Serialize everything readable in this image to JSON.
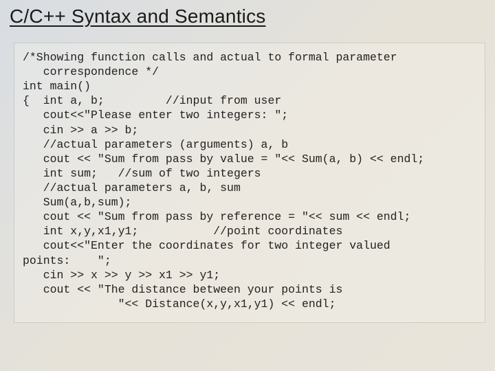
{
  "slide": {
    "title": "C/C++ Syntax and Semantics",
    "code": {
      "line1": "/*Showing function calls and actual to formal parameter",
      "line2": "   correspondence */",
      "line3": "int main()",
      "line4": "{  int a, b;         //input from user",
      "line5": "   cout<<\"Please enter two integers: \";",
      "line6": "   cin >> a >> b;",
      "line7": "   //actual parameters (arguments) a, b",
      "line8": "   cout << \"Sum from pass by value = \"<< Sum(a, b) << endl;",
      "line9": "   int sum;   //sum of two integers",
      "line10": "   //actual parameters a, b, sum",
      "line11": "   Sum(a,b,sum);",
      "line12": "   cout << \"Sum from pass by reference = \"<< sum << endl;",
      "line13": "   int x,y,x1,y1;           //point coordinates",
      "line14a": "   cout<<\"Enter the coordinates for two integer valued",
      "line14b": "points:    \";",
      "line15": "   cin >> x >> y >> x1 >> y1;",
      "line16a": "   cout << \"The distance between your points is",
      "line16b": "              \"<< Distance(x,y,x1,y1) << endl;"
    }
  }
}
